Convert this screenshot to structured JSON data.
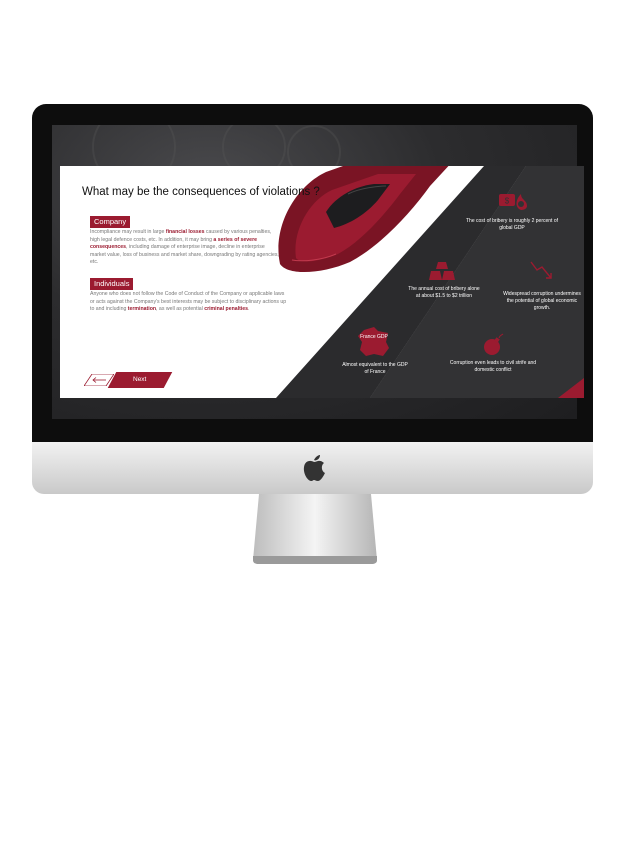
{
  "slide": {
    "title": "What may be the consequences of violations ?",
    "company": {
      "tag": "Company",
      "t1": "Incompliance may result in large ",
      "h1": "financial losses",
      "t2": " caused by various penalties, high legal defence costs, etc. In addition, it may bring ",
      "h2": "a series of severe consequences",
      "t3": ", including damage of enterprise image, decline in enterprise market value, loss of business and market share, downgrading by rating agencies, etc."
    },
    "individuals": {
      "tag": "Individuals",
      "t1": "Anyone who does not follow the Code of Conduct of the Company or applicable laws or acts against the Company's best interests may be subject to disciplinary actions up to and including ",
      "h1": "termination",
      "t2": ", as well as potential ",
      "h2": "criminal penalties",
      "t3": "."
    },
    "next_label": "Next",
    "facts": [
      {
        "text": "The cost of bribery is roughly 2 percent of global GDP",
        "icon": "money-fire-icon"
      },
      {
        "text": "The annual cost of bribery alone at about $1.5 to $2 trillion",
        "icon": "gold-bars-icon"
      },
      {
        "text": "Widespread corruption undermines the potential of global economic growth.",
        "icon": "decline-chart-icon"
      },
      {
        "text": "Almost equivalent to the GDP of France",
        "icon": "france-map-icon"
      },
      {
        "text": "Corruption even leads to civil strife and domestic conflict",
        "icon": "bomb-icon"
      }
    ],
    "france_label": "France GDP"
  },
  "colors": {
    "accent": "#9b1b30",
    "dark_panel": "#333335",
    "slide_bg": "#ffffff"
  }
}
